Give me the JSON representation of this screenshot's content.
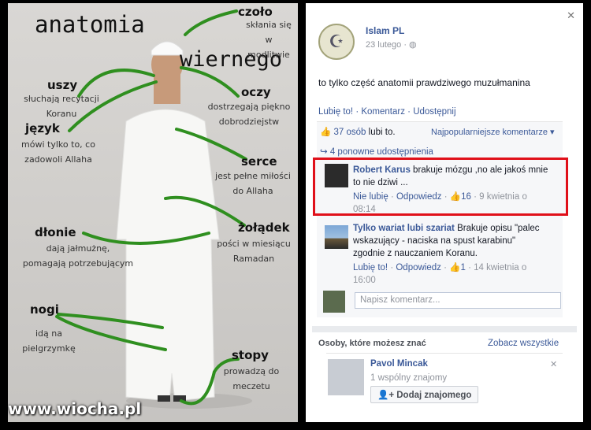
{
  "infographic": {
    "title_line1": "anatomia",
    "title_line2": "wiernego",
    "labels": {
      "czolo": {
        "title": "czoło",
        "desc": [
          "skłania się w",
          "modlitwie"
        ]
      },
      "uszy": {
        "title": "uszy",
        "desc": [
          "słuchają recytacji",
          "Koranu"
        ]
      },
      "oczy": {
        "title": "oczy",
        "desc": [
          "dostrzegają piękno",
          "dobrodziejstw"
        ]
      },
      "jezyk": {
        "title": "język",
        "desc": [
          "mówi tylko to, co",
          "zadowoli Allaha"
        ]
      },
      "serce": {
        "title": "serce",
        "desc": [
          "jest pełne miłości",
          "do Allaha"
        ]
      },
      "zoladek": {
        "title": "żołądek",
        "desc": [
          "pości w miesiącu",
          "Ramadan"
        ]
      },
      "dlonie": {
        "title": "dłonie",
        "desc": [
          "dają jałmużnę,",
          "pomagają potrzebującym"
        ]
      },
      "nogi": {
        "title": "nogi",
        "desc": [
          "idą na",
          "pielgrzymkę"
        ]
      },
      "stopy": {
        "title": "stopy",
        "desc": [
          "prowadzą do",
          "meczetu"
        ]
      }
    },
    "watermark": "www.wiocha.pl",
    "line_color": "#2f8f1f"
  },
  "post": {
    "page_name": "Islam PL",
    "date": "23 lutego · ",
    "globe_icon": "globe-icon",
    "text": "to tylko część anatomii prawdziwego muzułmanina",
    "actions": [
      "Lubię to!",
      " · ",
      "Komentarz",
      " · ",
      "Udostępnij"
    ],
    "likes": "37 osób",
    "likes_suffix": " lubi to.",
    "sort": "Najpopularniejsze komentarze ▾",
    "shares": "4 ponowne udostępnienia"
  },
  "comments": [
    {
      "author": "Robert Karus",
      "text_line1": " brakuje mózgu ,no ale jakoś mnie",
      "text_line2": "to nie dziwi ...",
      "unlike": "Nie lubię",
      "reply": "Odpowiedz",
      "likes": "16",
      "time_line1": "9 kwietnia o",
      "time_line2": "08:14"
    },
    {
      "author": "Tylko wariat lubi szariat",
      "text_line1": " Brakuje opisu \"palec",
      "text_line2": "wskazujący - naciska na spust karabinu\"",
      "text_line3": "zgodnie z nauczaniem Koranu.",
      "like": "Lubię to!",
      "reply": "Odpowiedz",
      "likes": "1",
      "time_line1": "14 kwietnia o",
      "time_line2": "16:00"
    }
  ],
  "comment_input": {
    "placeholder": "Napisz komentarz..."
  },
  "suggestions": {
    "heading": "Osoby, które możesz znać",
    "see_all": "Zobacz wszystkie",
    "person": {
      "name": "Pavol Mincak",
      "mutual": "1 wspólny znajomy",
      "add_label": "Dodaj znajomego"
    }
  }
}
